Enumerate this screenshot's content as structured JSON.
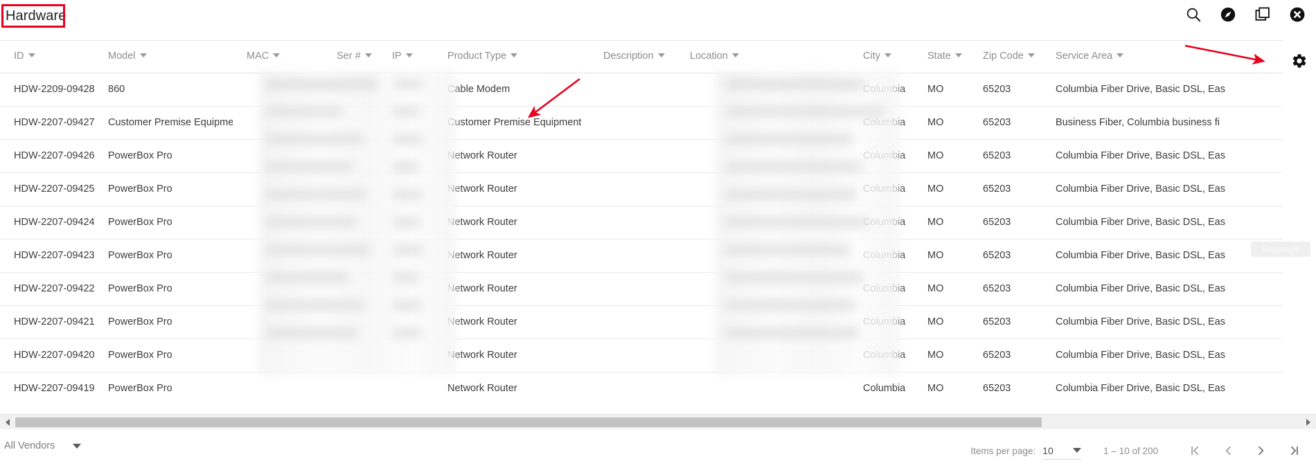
{
  "header": {
    "title": "Hardware",
    "icons": [
      {
        "name": "search-icon"
      },
      {
        "name": "compass-icon"
      },
      {
        "name": "duplicate-icon"
      },
      {
        "name": "close-circle-icon"
      }
    ]
  },
  "table": {
    "settings_icon": "gear-icon",
    "columns": [
      {
        "key": "id",
        "label": "ID",
        "sortable": true,
        "redacted": false
      },
      {
        "key": "model",
        "label": "Model",
        "sortable": true,
        "redacted": false
      },
      {
        "key": "mac",
        "label": "MAC",
        "sortable": true,
        "redacted": true
      },
      {
        "key": "ser",
        "label": "Ser #",
        "sortable": true,
        "redacted": true
      },
      {
        "key": "ip",
        "label": "IP",
        "sortable": true,
        "redacted": true
      },
      {
        "key": "product_type",
        "label": "Product Type",
        "sortable": true,
        "redacted": false
      },
      {
        "key": "description",
        "label": "Description",
        "sortable": true,
        "redacted": true
      },
      {
        "key": "location",
        "label": "Location",
        "sortable": true,
        "redacted": true
      },
      {
        "key": "city",
        "label": "City",
        "sortable": true,
        "redacted": false
      },
      {
        "key": "state",
        "label": "State",
        "sortable": true,
        "redacted": false
      },
      {
        "key": "zip",
        "label": "Zip Code",
        "sortable": true,
        "redacted": false
      },
      {
        "key": "service_area",
        "label": "Service Area",
        "sortable": true,
        "redacted": false
      }
    ],
    "rows": [
      {
        "id": "HDW-2209-09428",
        "model": "860",
        "mac": "",
        "ser": "",
        "ip": "",
        "product_type": "Cable Modem",
        "description": "",
        "location": "",
        "city": "Columbia",
        "state": "MO",
        "zip": "65203",
        "service_area": "Columbia Fiber Drive, Basic DSL, Eas"
      },
      {
        "id": "HDW-2207-09427",
        "model": "Customer Premise Equipment",
        "mac": "",
        "ser": "",
        "ip": "",
        "product_type": "Customer Premise Equipment",
        "description": "",
        "location": "",
        "city": "Columbia",
        "state": "MO",
        "zip": "65203",
        "service_area": "Business Fiber, Columbia business fi"
      },
      {
        "id": "HDW-2207-09426",
        "model": "PowerBox Pro",
        "mac": "",
        "ser": "",
        "ip": "",
        "product_type": "Network Router",
        "description": "",
        "location": "",
        "city": "Columbia",
        "state": "MO",
        "zip": "65203",
        "service_area": "Columbia Fiber Drive, Basic DSL, Eas"
      },
      {
        "id": "HDW-2207-09425",
        "model": "PowerBox Pro",
        "mac": "",
        "ser": "",
        "ip": "",
        "product_type": "Network Router",
        "description": "",
        "location": "",
        "city": "Columbia",
        "state": "MO",
        "zip": "65203",
        "service_area": "Columbia Fiber Drive, Basic DSL, Eas"
      },
      {
        "id": "HDW-2207-09424",
        "model": "PowerBox Pro",
        "mac": "",
        "ser": "",
        "ip": "",
        "product_type": "Network Router",
        "description": "",
        "location": "",
        "city": "Columbia",
        "state": "MO",
        "zip": "65203",
        "service_area": "Columbia Fiber Drive, Basic DSL, Eas"
      },
      {
        "id": "HDW-2207-09423",
        "model": "PowerBox Pro",
        "mac": "",
        "ser": "",
        "ip": "",
        "product_type": "Network Router",
        "description": "",
        "location": "",
        "city": "Columbia",
        "state": "MO",
        "zip": "65203",
        "service_area": "Columbia Fiber Drive, Basic DSL, Eas"
      },
      {
        "id": "HDW-2207-09422",
        "model": "PowerBox Pro",
        "mac": "",
        "ser": "",
        "ip": "",
        "product_type": "Network Router",
        "description": "",
        "location": "",
        "city": "Columbia",
        "state": "MO",
        "zip": "65203",
        "service_area": "Columbia Fiber Drive, Basic DSL, Eas"
      },
      {
        "id": "HDW-2207-09421",
        "model": "PowerBox Pro",
        "mac": "",
        "ser": "",
        "ip": "",
        "product_type": "Network Router",
        "description": "",
        "location": "",
        "city": "Columbia",
        "state": "MO",
        "zip": "65203",
        "service_area": "Columbia Fiber Drive, Basic DSL, Eas"
      },
      {
        "id": "HDW-2207-09420",
        "model": "PowerBox Pro",
        "mac": "",
        "ser": "",
        "ip": "",
        "product_type": "Network Router",
        "description": "",
        "location": "",
        "city": "Columbia",
        "state": "MO",
        "zip": "65203",
        "service_area": "Columbia Fiber Drive, Basic DSL, Eas"
      },
      {
        "id": "HDW-2207-09419",
        "model": "PowerBox Pro",
        "mac": "",
        "ser": "",
        "ip": "",
        "product_type": "Network Router",
        "description": "",
        "location": "",
        "city": "Columbia",
        "state": "MO",
        "zip": "65203",
        "service_area": "Columbia Fiber Drive, Basic DSL, Eas"
      }
    ]
  },
  "ghost_label": {
    "text": "Rectangle"
  },
  "footer": {
    "vendor_filter": {
      "value": "All Vendors"
    },
    "paginator": {
      "items_per_page_label": "Items per page:",
      "items_per_page_value": "10",
      "range_label": "1 – 10 of 200",
      "first_page": "first-page",
      "prev_page": "previous-page",
      "next_page": "next-page",
      "last_page": "last-page"
    }
  },
  "annotations": {
    "accent_color": "#e8001c",
    "title_highlight": "Hardware",
    "arrow_1_target": "Customer Premise Equipment",
    "arrow_2_target": "gear-icon"
  }
}
